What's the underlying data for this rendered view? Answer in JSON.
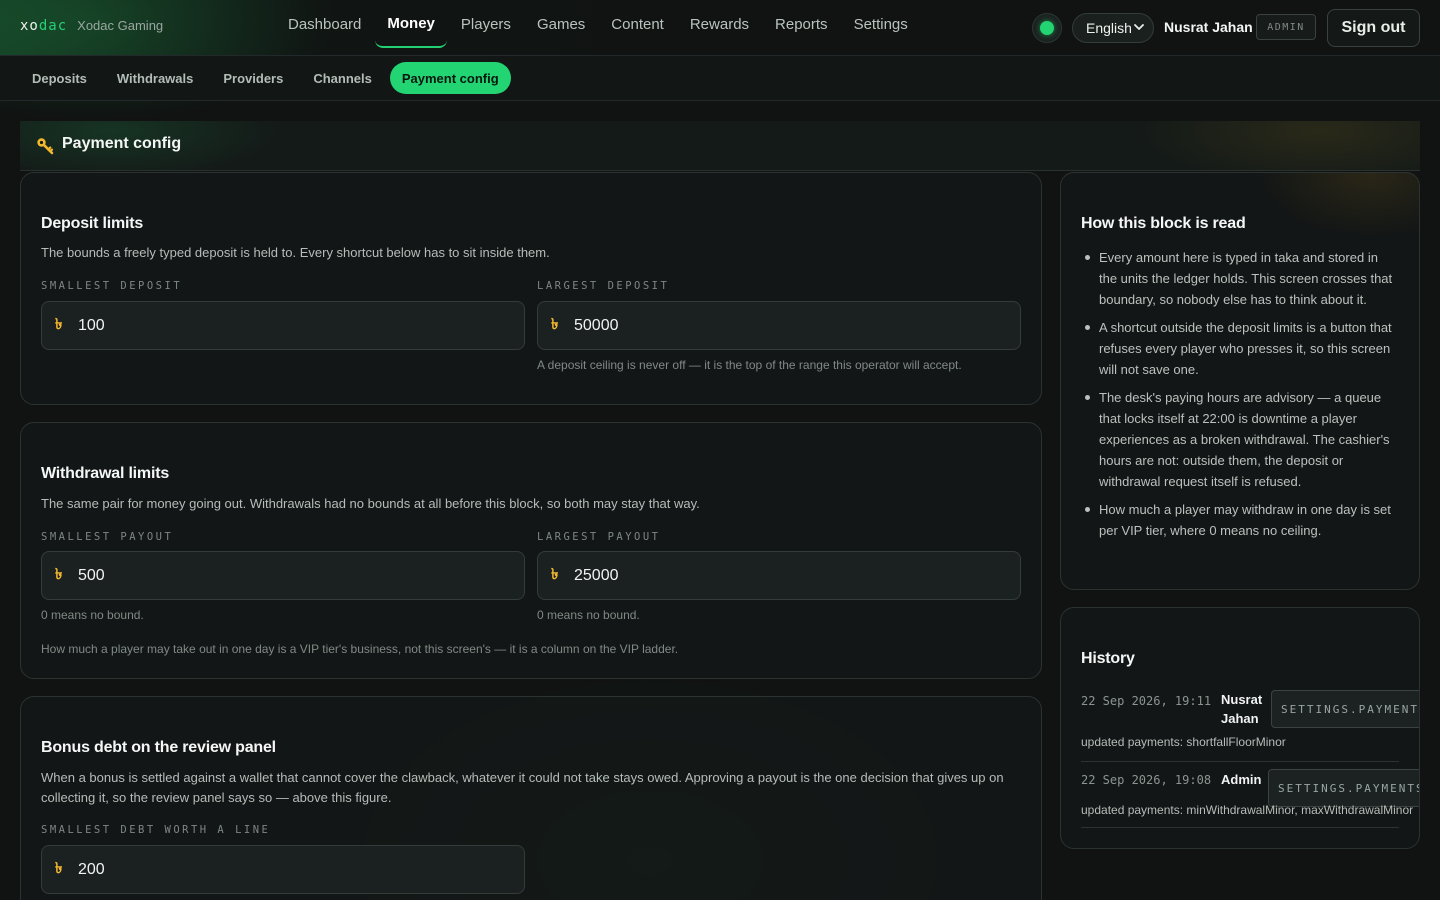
{
  "brand": {
    "logo_prefix": "xo",
    "logo_accent": "dac",
    "name": "Xodac Gaming"
  },
  "nav": {
    "items": [
      {
        "label": "Dashboard"
      },
      {
        "label": "Money",
        "active": true
      },
      {
        "label": "Players"
      },
      {
        "label": "Games"
      },
      {
        "label": "Content"
      },
      {
        "label": "Rewards"
      },
      {
        "label": "Reports"
      },
      {
        "label": "Settings"
      }
    ]
  },
  "header": {
    "status_color": "#22d472",
    "language": "English",
    "user_name": "Nusrat Jahan",
    "role_badge": "ADMIN",
    "signout_label": "Sign out"
  },
  "subnav": {
    "items": [
      {
        "label": "Deposits"
      },
      {
        "label": "Withdrawals"
      },
      {
        "label": "Providers"
      },
      {
        "label": "Channels"
      },
      {
        "label": "Payment config",
        "active": true
      }
    ]
  },
  "page": {
    "title": "Payment config",
    "icon": "key-icon"
  },
  "currency_symbol": "৳",
  "deposit": {
    "title": "Deposit limits",
    "description": "The bounds a freely typed deposit is held to. Every shortcut below has to sit inside them.",
    "min_label": "SMALLEST DEPOSIT",
    "min_value": "100",
    "max_label": "LARGEST DEPOSIT",
    "max_value": "50000",
    "max_hint": "A deposit ceiling is never off — it is the top of the range this operator will accept."
  },
  "withdrawal": {
    "title": "Withdrawal limits",
    "description": "The same pair for money going out. Withdrawals had no bounds at all before this block, so both may stay that way.",
    "min_label": "SMALLEST PAYOUT",
    "min_value": "500",
    "min_hint": "0 means no bound.",
    "max_label": "LARGEST PAYOUT",
    "max_value": "25000",
    "max_hint": "0 means no bound.",
    "footnote": "How much a player may take out in one day is a VIP tier's business, not this screen's — it is a column on the VIP ladder."
  },
  "bonus_debt": {
    "title": "Bonus debt on the review panel",
    "description": "When a bonus is settled against a wallet that cannot cover the clawback, whatever it could not take stays owed. Approving a payout is the one decision that gives up on collecting it, so the review panel says so — above this figure.",
    "min_label": "SMALLEST DEBT WORTH A LINE",
    "min_value": "200"
  },
  "help": {
    "title": "How this block is read",
    "items": [
      "Every amount here is typed in taka and stored in the units the ledger holds. This screen crosses that boundary, so nobody else has to think about it.",
      "A shortcut outside the deposit limits is a button that refuses every player who presses it, so this screen will not save one.",
      "The desk's paying hours are advisory — a queue that locks itself at 22:00 is downtime a player experiences as a broken withdrawal. The cashier's hours are not: outside them, the deposit or withdrawal request itself is refused.",
      "How much a player may withdraw in one day is set per VIP tier, where 0 means no ceiling."
    ]
  },
  "history": {
    "title": "History",
    "entries": [
      {
        "time": "22 Sep 2026, 19:11",
        "actor": "Nusrat Jahan",
        "tag": "SETTINGS.PAYMENTS",
        "detail": "updated payments: shortfallFloorMinor"
      },
      {
        "time": "22 Sep 2026, 19:08",
        "actor": "Admin",
        "tag": "SETTINGS.PAYMENTS",
        "detail": "updated payments: minWithdrawalMinor, maxWithdrawalMinor"
      }
    ]
  }
}
